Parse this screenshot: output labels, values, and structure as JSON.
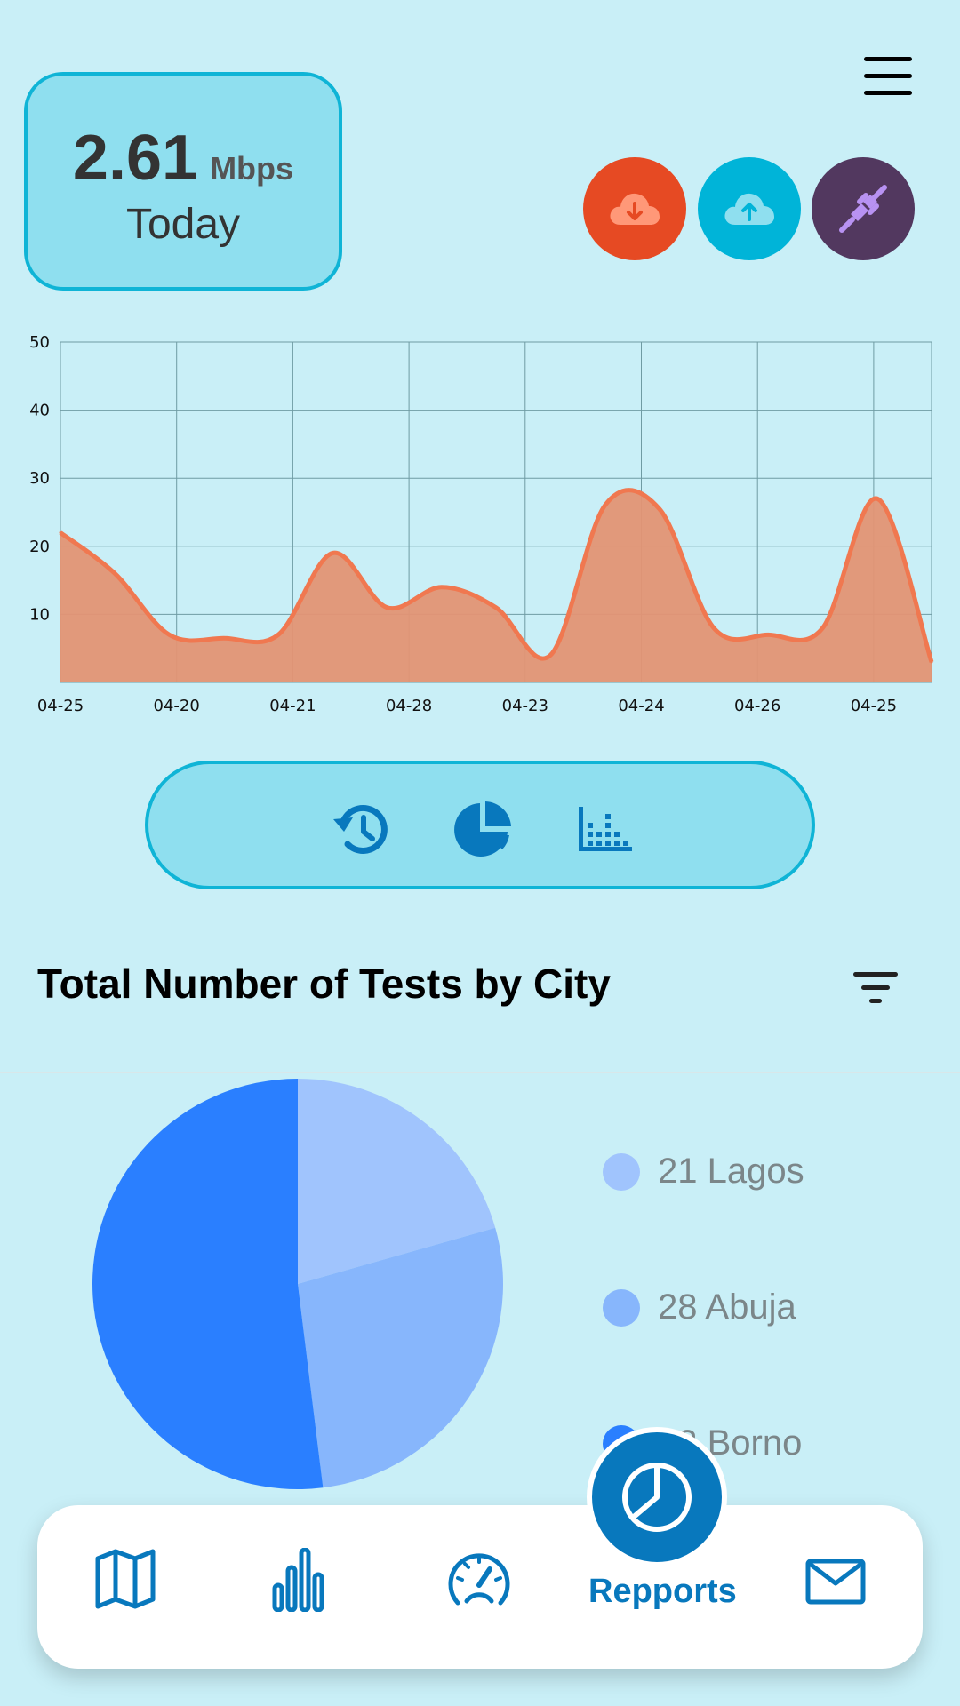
{
  "header": {
    "menu_icon": "hamburger-menu-icon",
    "speed": {
      "value": "2.61",
      "unit": "Mbps",
      "label": "Today"
    },
    "actions": [
      {
        "name": "download-button",
        "icon": "cloud-download-icon",
        "color": "#e64a23"
      },
      {
        "name": "upload-button",
        "icon": "cloud-upload-icon",
        "color": "#00b4d8"
      },
      {
        "name": "connection-button",
        "icon": "plug-icon",
        "color": "#52385f"
      }
    ]
  },
  "chart_data": {
    "type": "area",
    "x": [
      "04-25",
      "04-20",
      "04-21",
      "04-28",
      "04-23",
      "04-24",
      "04-26",
      "04-25"
    ],
    "y_ticks": [
      "10",
      "20",
      "30",
      "40",
      "50"
    ],
    "ylim": [
      0,
      50
    ],
    "grid": true,
    "series": [
      {
        "values": [
          22,
          16,
          7,
          6.5,
          7,
          19,
          11,
          14,
          11,
          4,
          26,
          25.5,
          8,
          7,
          8,
          27,
          3
        ]
      }
    ],
    "colors": {
      "line": "#f07850",
      "fill": "#e39474"
    }
  },
  "toolbar": {
    "items": [
      {
        "name": "history-button",
        "icon": "history-icon"
      },
      {
        "name": "pie-chart-button",
        "icon": "pie-chart-icon"
      },
      {
        "name": "bar-chart-button",
        "icon": "bar-chart-icon"
      }
    ]
  },
  "tests_section": {
    "title": "Total Number of Tests by City",
    "filter_icon": "filter-icon"
  },
  "pie": {
    "slices": [
      {
        "value": 21,
        "city": "Lagos",
        "color": "#a0c4fd"
      },
      {
        "value": 28,
        "city": "Abuja",
        "color": "#87b6fc"
      },
      {
        "value": 53,
        "city": "Borno",
        "color": "#2a7fff"
      }
    ],
    "legend": [
      {
        "text": "21 Lagos",
        "color": "#a0c4fd"
      },
      {
        "text": "28 Abuja",
        "color": "#87b6fc"
      },
      {
        "text": "53 Borno",
        "color": "#2a7fff"
      }
    ]
  },
  "bottom_nav": {
    "items": [
      {
        "name": "nav-map",
        "icon": "map-icon"
      },
      {
        "name": "nav-stats",
        "icon": "bar-chart-icon"
      },
      {
        "name": "nav-speedtest",
        "icon": "speedometer-icon"
      },
      {
        "name": "nav-reports",
        "icon": "pie-chart-icon",
        "label": "Repports",
        "active": true
      },
      {
        "name": "nav-mail",
        "icon": "mail-icon"
      }
    ],
    "accent": "#0878bd"
  }
}
